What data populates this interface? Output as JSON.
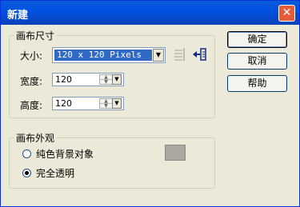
{
  "window": {
    "title": "新建",
    "close_glyph": "✕"
  },
  "canvas_size": {
    "legend": "画布尺寸",
    "size_label": "大小:",
    "size_value": "120 x 120 Pixels",
    "width_label": "宽度:",
    "width_value": "120",
    "height_label": "高度:",
    "height_value": "120"
  },
  "canvas_appearance": {
    "legend": "画布外观",
    "option_solid": "纯色背景对象",
    "option_transparent": "完全透明",
    "selected": "完全透明",
    "swatch_color": "#aaa89f"
  },
  "buttons": {
    "ok": "确定",
    "cancel": "取消",
    "help": "帮助"
  },
  "icons": {
    "size_pixels": "pixel-grid-icon",
    "size_apply": "arrow-into-icon"
  }
}
